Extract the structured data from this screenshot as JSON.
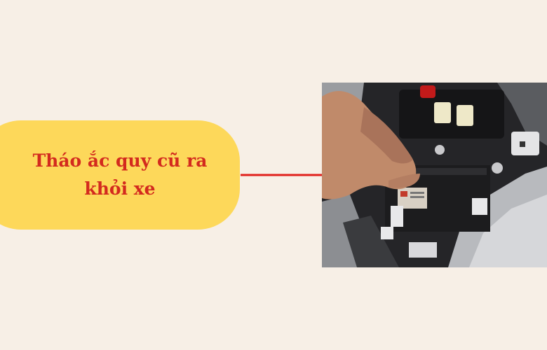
{
  "callout": {
    "text": "Tháo ắc quy cũ ra khỏi xe"
  },
  "colors": {
    "background": "#f7efe6",
    "callout_fill": "#fdd85a",
    "callout_text": "#d32a1e",
    "arrow": "#e0201c"
  },
  "photo": {
    "content": "motorcycle-battery-compartment"
  }
}
